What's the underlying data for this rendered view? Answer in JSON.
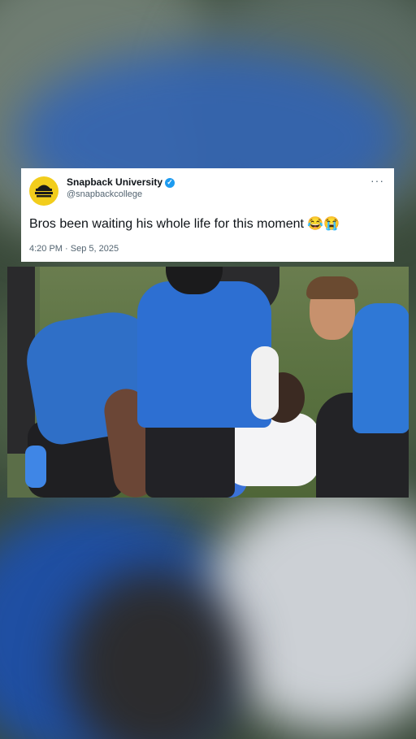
{
  "tweet": {
    "display_name": "Snapback University",
    "handle": "@snapbackcollege",
    "verified_glyph": "✓",
    "more_glyph": "···",
    "text": "Bros been waiting his whole life for this moment 😂😭",
    "timestamp": "4:20 PM · Sep 5, 2025",
    "avatar_text": "SNAPBACK UNIVERSITY",
    "colors": {
      "avatar_bg": "#f2cd1c",
      "verified": "#1d9bf0",
      "secondary_text": "#536471"
    }
  },
  "media": {
    "icon": "video-frame",
    "description_icon": "football-field-scene"
  }
}
